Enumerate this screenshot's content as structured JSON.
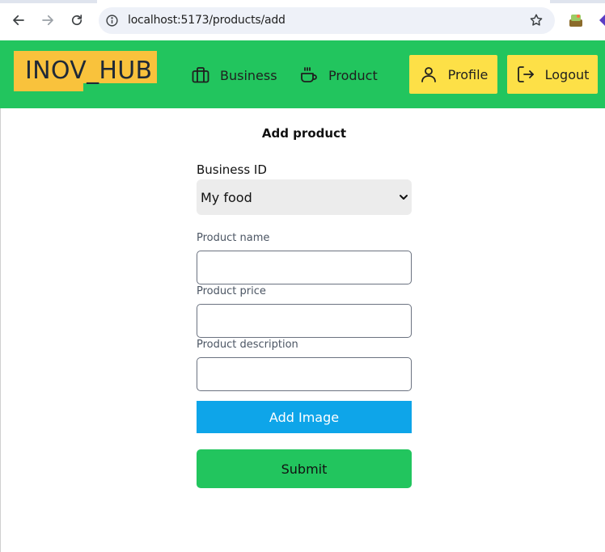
{
  "browser": {
    "url": "localhost:5173/products/add",
    "icons": [
      "back-icon",
      "forward-icon",
      "reload-icon",
      "site-info-icon",
      "bookmark-star-icon",
      "extension-icon"
    ]
  },
  "header": {
    "logo": "INOV_HUB",
    "nav": [
      {
        "label": "Business",
        "icon": "briefcase-icon"
      },
      {
        "label": "Product",
        "icon": "coffee-cup-icon"
      }
    ],
    "profile_label": "Profile",
    "logout_label": "Logout"
  },
  "form": {
    "title": "Add product",
    "business_label": "Business ID",
    "business_selected": "My food",
    "fields": [
      {
        "label": "Product name",
        "value": ""
      },
      {
        "label": "Product price",
        "value": ""
      },
      {
        "label": "Product description",
        "value": ""
      }
    ],
    "add_image_label": "Add Image",
    "submit_label": "Submit"
  },
  "colors": {
    "header_bg": "#22c55e",
    "logo_bg": "#f9c23c",
    "header_button_bg": "#fde047",
    "add_image_bg": "#0ea5e9",
    "submit_bg": "#22c55e"
  }
}
